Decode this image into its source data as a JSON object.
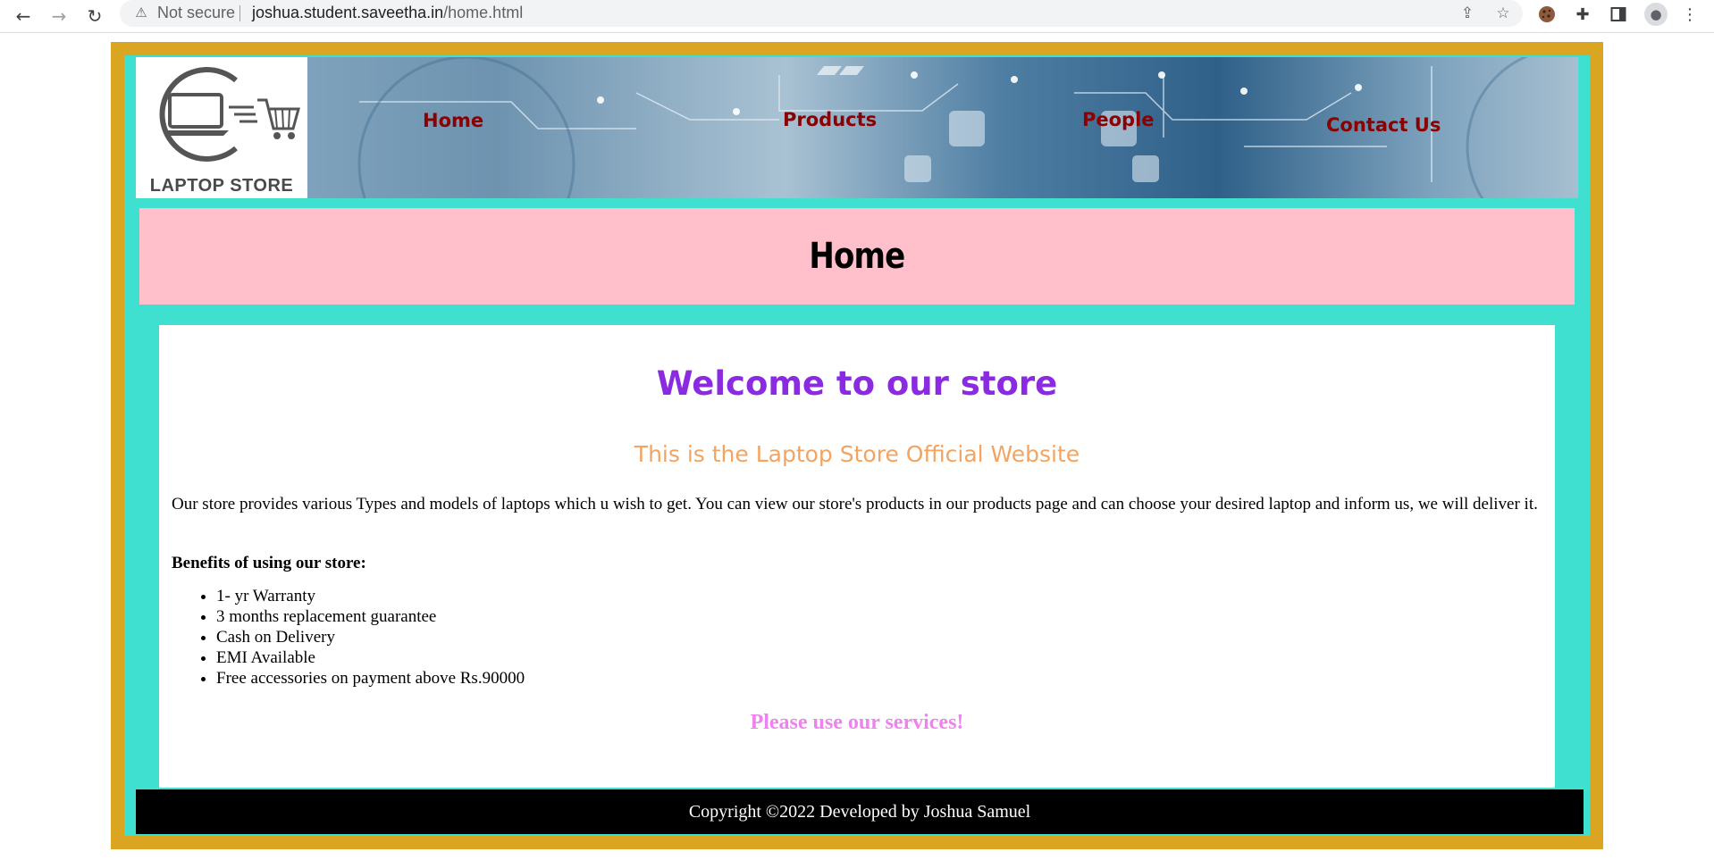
{
  "browser": {
    "back_icon": "arrow-left-icon",
    "forward_icon": "arrow-right-icon",
    "reload_icon": "reload-icon",
    "security_label": "Not secure",
    "url_host": "joshua.student.saveetha.in",
    "url_path": "/home.html"
  },
  "site": {
    "logo_text": "LAPTOP STORE",
    "nav": [
      {
        "label": "Home"
      },
      {
        "label": "Products"
      },
      {
        "label": "People"
      },
      {
        "label": "Contact Us"
      }
    ],
    "banner_title": "Home"
  },
  "content": {
    "welcome": "Welcome to our store",
    "subtitle": "This is the Laptop Store Official Website",
    "paragraph": "Our store provides various Types and models of laptops which u wish to get. You can view our store's products in our products page and can choose your desired laptop and inform us, we will deliver it.",
    "benefits_title": "Benefits of using our store:",
    "benefits": [
      "1- yr Warranty",
      "3 months replacement guarantee",
      "Cash on Delivery",
      "EMI Available",
      "Free accessories on payment above Rs.90000"
    ],
    "services_text": "Please use our services!"
  },
  "footer": {
    "copyright": "Copyright ©2022 Developed by Joshua Samuel"
  },
  "colors": {
    "outer_border": "#DAA520",
    "inner_bg": "#40E0D0",
    "banner_bg": "#FFC0CB",
    "nav_link": "#8B0000",
    "welcome": "#8A2BE2",
    "subtitle": "#F4A460",
    "services": "#EE82EE",
    "footer_bg": "#000000"
  }
}
